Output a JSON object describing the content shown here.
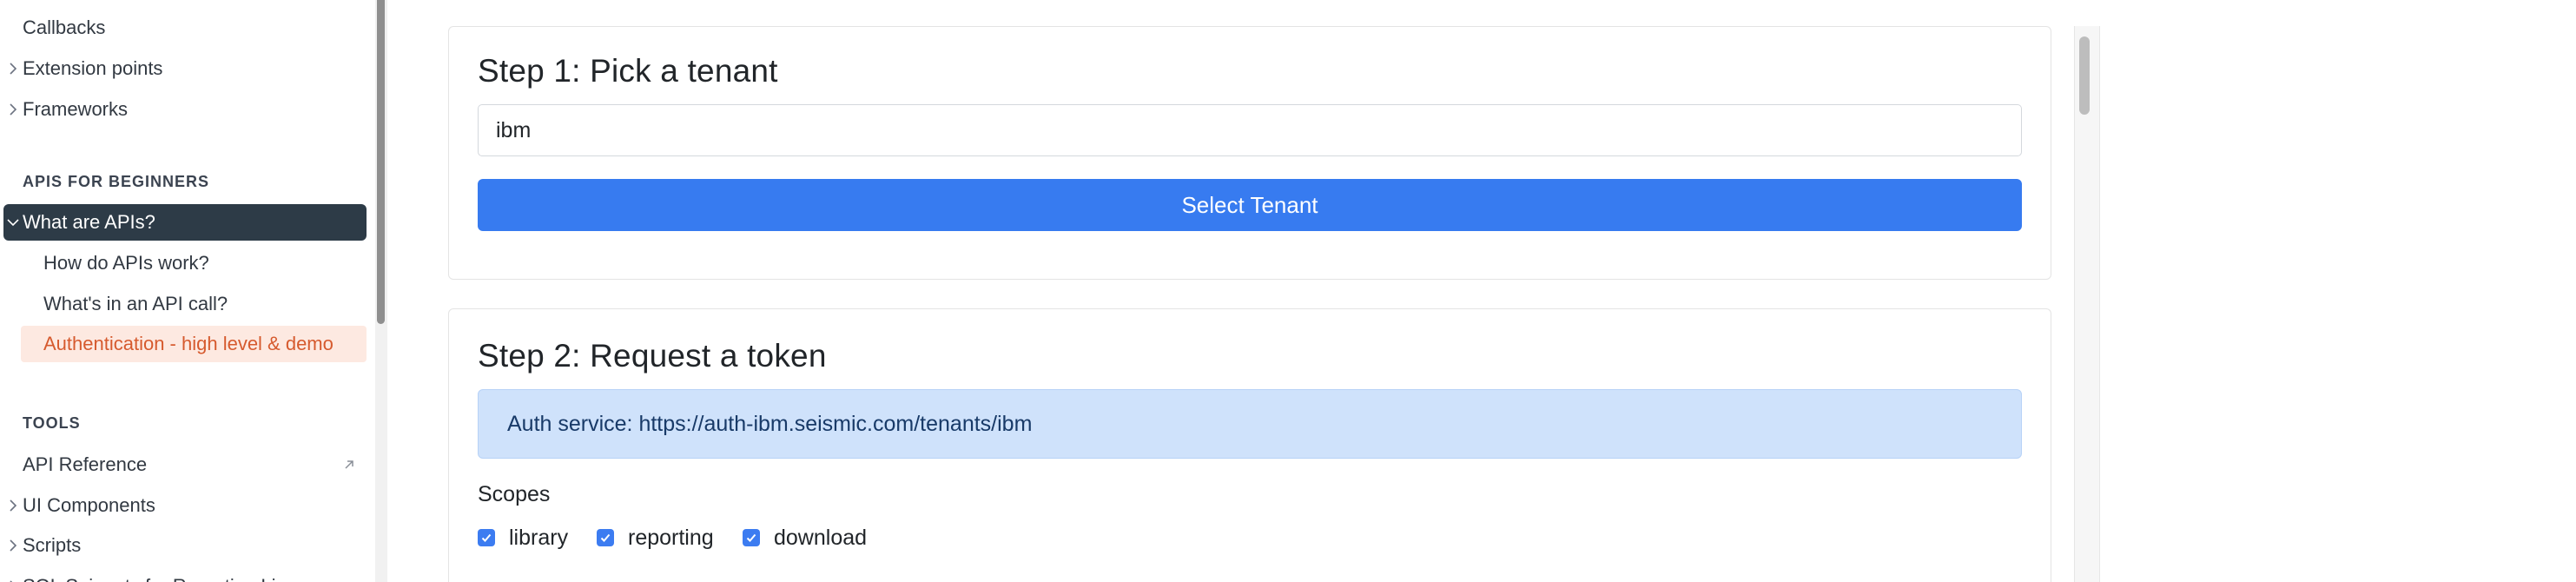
{
  "sidebar": {
    "items_top": [
      {
        "label": "Callbacks",
        "chevron": false
      },
      {
        "label": "Extension points",
        "chevron": true
      },
      {
        "label": "Frameworks",
        "chevron": true
      }
    ],
    "section_beginners": "APIS FOR BEGINNERS",
    "beginners": {
      "parent": "What are APIs?",
      "children": [
        "How do APIs work?",
        "What's in an API call?",
        "Authentication - high level & demo"
      ]
    },
    "section_tools": "TOOLS",
    "tools": [
      {
        "label": "API Reference",
        "external": true
      },
      {
        "label": "UI Components",
        "chevron": true
      },
      {
        "label": "Scripts",
        "chevron": true
      },
      {
        "label": "SQL Snippets for Reporting Lin...",
        "chevron": true
      }
    ]
  },
  "step1": {
    "title": "Step 1: Pick a tenant",
    "tenant_value": "ibm",
    "button_label": "Select Tenant"
  },
  "step2": {
    "title": "Step 2: Request a token",
    "auth_service": "Auth service: https://auth-ibm.seismic.com/tenants/ibm",
    "scopes_label": "Scopes",
    "scopes": [
      {
        "label": "library",
        "checked": true
      },
      {
        "label": "reporting",
        "checked": true
      },
      {
        "label": "download",
        "checked": true
      }
    ]
  },
  "colors": {
    "primary_button": "#377bf0",
    "active_nav": "#2d3b47",
    "active_child_text": "#d65a2e",
    "active_child_bg": "#fde9e1",
    "alert_bg": "#cfe2fb"
  },
  "icons": {
    "chevron_right": "chevron-right-icon",
    "chevron_down": "chevron-down-icon",
    "external_link": "external-link-icon",
    "checkbox_checked": "checkbox-checked-icon"
  }
}
